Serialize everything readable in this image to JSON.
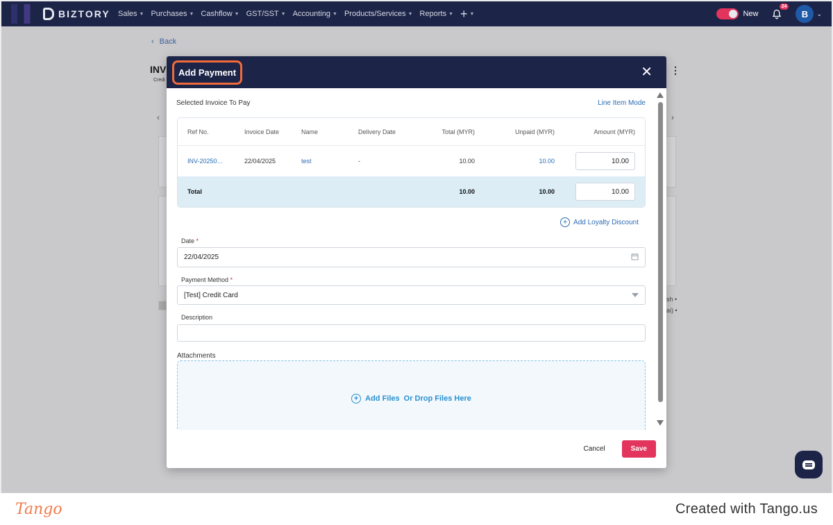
{
  "nav": {
    "brand": "BIZTORY",
    "items": [
      {
        "label": "Sales"
      },
      {
        "label": "Purchases"
      },
      {
        "label": "Cashflow"
      },
      {
        "label": "GST/SST"
      },
      {
        "label": "Accounting"
      },
      {
        "label": "Products/Services"
      },
      {
        "label": "Reports"
      }
    ],
    "toggle_label": "New",
    "notification_count": "24",
    "avatar_initial": "B"
  },
  "background": {
    "back_label": "Back",
    "invoice_fragment": "INV",
    "credit_fragment": "Credi",
    "frag_a": "sh •",
    "frag_b": "ai) •"
  },
  "modal": {
    "title": "Add Payment",
    "section_title": "Selected Invoice To Pay",
    "line_item_mode": "Line Item Mode",
    "table": {
      "headers": {
        "ref": "Ref No.",
        "date": "Invoice Date",
        "name": "Name",
        "delivery": "Delivery Date",
        "total": "Total (MYR)",
        "unpaid": "Unpaid (MYR)",
        "amount": "Amount (MYR)"
      },
      "rows": [
        {
          "ref": "INV-20250…",
          "date": "22/04/2025",
          "name": "test",
          "delivery": "-",
          "total": "10.00",
          "unpaid": "10.00",
          "amount": "10.00"
        }
      ],
      "total_row": {
        "label": "Total",
        "total": "10.00",
        "unpaid": "10.00",
        "amount": "10.00"
      }
    },
    "loyalty_label": "Add Loyalty Discount",
    "date_label": "Date",
    "date_value": "22/04/2025",
    "payment_method_label": "Payment Method",
    "payment_method_value": "[Test] Credit Card",
    "description_label": "Description",
    "description_value": "",
    "attachments_label": "Attachments",
    "dropzone_add": "Add Files",
    "dropzone_drop": "Or Drop Files Here",
    "cancel_label": "Cancel",
    "save_label": "Save",
    "required_mark": "*"
  },
  "footer": {
    "tango_logo": "Tango",
    "credit": "Created with Tango.us"
  },
  "colors": {
    "nav_bg": "#1c2447",
    "accent": "#e2345d",
    "link": "#2a6bb3",
    "highlight": "#f26b3a"
  }
}
